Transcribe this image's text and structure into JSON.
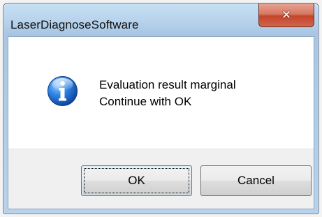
{
  "window": {
    "title": "LaserDiagnoseSoftware",
    "close_glyph": "✕"
  },
  "message": {
    "line1": "Evaluation result marginal",
    "line2": "Continue with OK",
    "icon": "information-icon"
  },
  "buttons": {
    "ok_label": "OK",
    "cancel_label": "Cancel"
  },
  "colors": {
    "accent": "#1c6ed6",
    "close_button": "#c4452b"
  }
}
